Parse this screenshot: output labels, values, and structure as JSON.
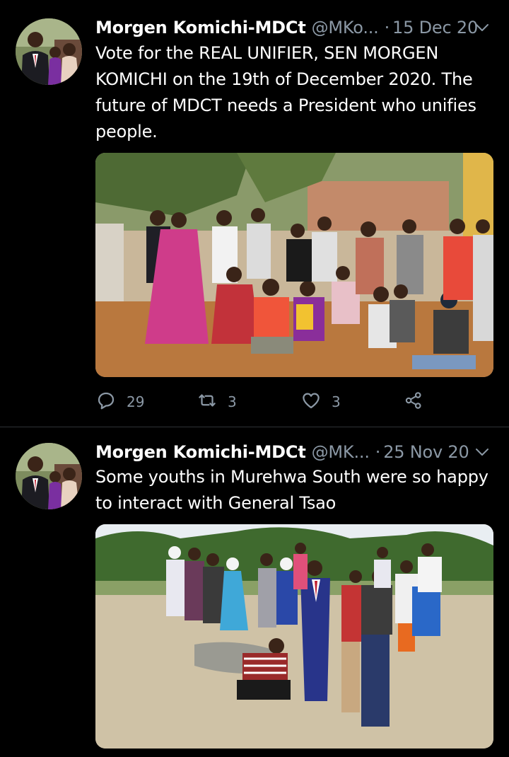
{
  "tweets": [
    {
      "author_name": "Morgen Komichi-MDCt",
      "handle": "@MKo...",
      "separator": "·",
      "date": "15 Dec 20",
      "text": "Vote for the REAL UNIFIER, SEN MORGEN KOMICHI on the 19th of December 2020. The future of MDCT needs a President who unifies people.",
      "replies": "29",
      "retweets": "3",
      "likes": "3"
    },
    {
      "author_name": "Morgen Komichi-MDCt",
      "handle": "@MK...",
      "separator": "·",
      "date": "25 Nov 20",
      "text": "Some youths in Murehwa South were so happy to interact with General Tsao"
    }
  ],
  "icons": {
    "reply": "reply-icon",
    "retweet": "retweet-icon",
    "like": "like-icon",
    "share": "share-icon",
    "more": "chevron-down-icon"
  },
  "colors": {
    "background": "#000000",
    "text_primary": "#ffffff",
    "text_secondary": "#8b98a5",
    "divider": "#2f3336"
  }
}
